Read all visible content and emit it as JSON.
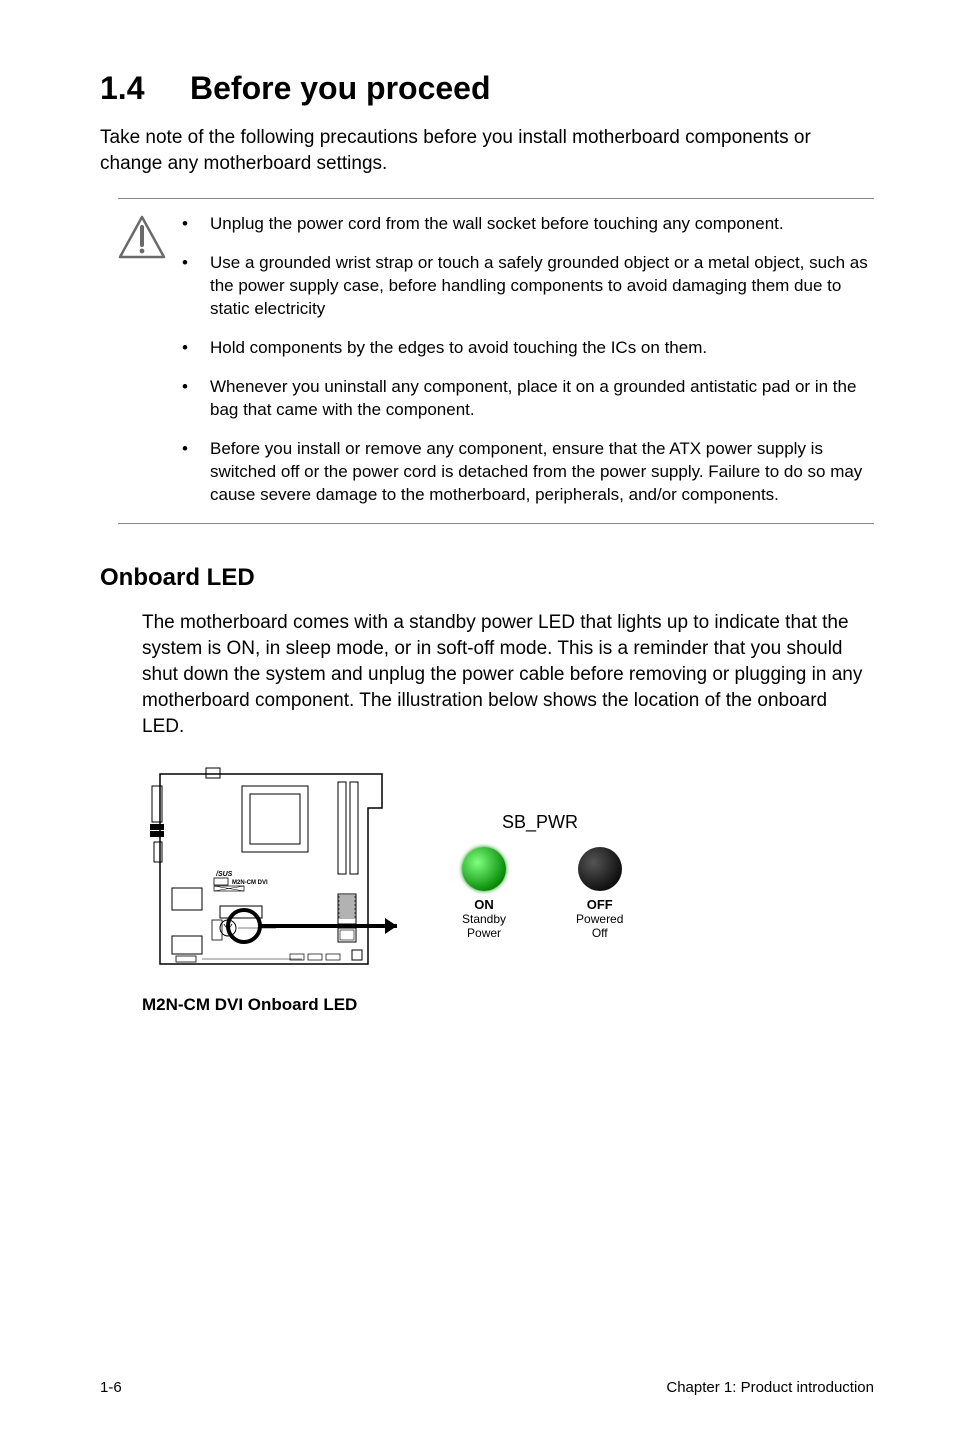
{
  "section": {
    "number": "1.4",
    "title": "Before you proceed"
  },
  "intro": "Take note of the following precautions before you install motherboard components or change any motherboard settings.",
  "caution_icon_name": "caution-icon",
  "precautions": [
    "Unplug the power cord from the wall socket before touching any component.",
    "Use a grounded wrist strap or touch a safely grounded object or a metal object, such as the power supply case, before handling components to avoid damaging them due to static electricity",
    "Hold components by the edges to avoid touching the ICs on them.",
    "Whenever you uninstall any component, place it on a grounded antistatic pad or in the bag that came with the component.",
    "Before you install or remove any component, ensure that the ATX power supply is switched off or the power cord is detached from the power supply. Failure to do so may cause severe damage to the motherboard, peripherals, and/or components."
  ],
  "onboard_led": {
    "heading": "Onboard LED",
    "description": "The motherboard comes with a standby power LED that lights up to indicate that the system is ON, in sleep mode, or in soft-off mode. This is a reminder that you should shut down the system and unplug the power cable before removing or plugging in any motherboard component. The illustration below shows the location of the onboard LED.",
    "board_label": "M2N-CM DVI",
    "diagram_caption": "M2N-CM DVI Onboard LED",
    "signal_label": "SB_PWR",
    "states": [
      {
        "label": "ON",
        "sub1": "Standby",
        "sub2": "Power"
      },
      {
        "label": "OFF",
        "sub1": "Powered",
        "sub2": "Off"
      }
    ]
  },
  "footer": {
    "left": "1-6",
    "right": "Chapter 1: Product introduction"
  }
}
